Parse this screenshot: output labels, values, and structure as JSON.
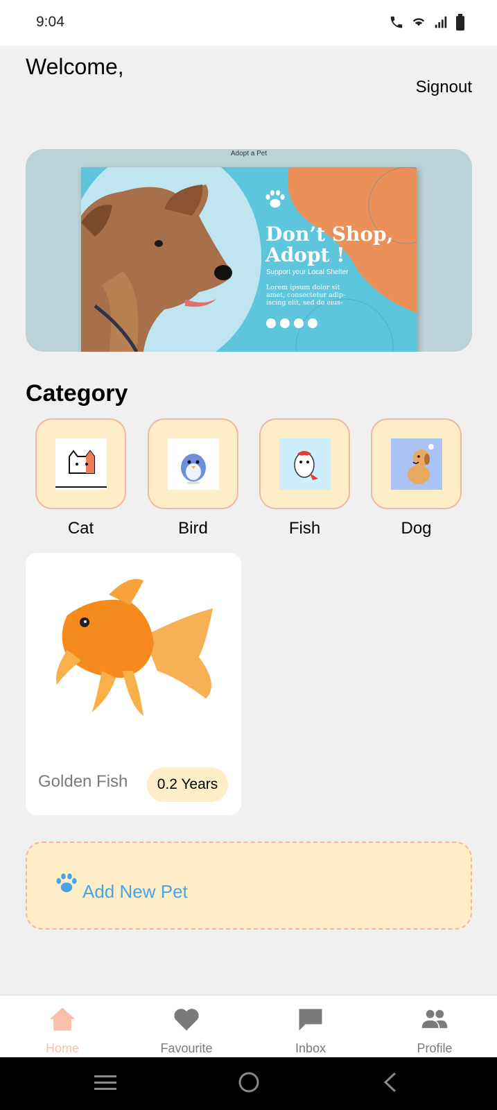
{
  "status_bar": {
    "time": "9:04"
  },
  "header": {
    "welcome": "Welcome,",
    "signout": "Signout"
  },
  "banner": {
    "caption": "Adopt a Pet",
    "headline_line1": "Don’t Shop,",
    "headline_line2": "Adopt !",
    "subtitle": "Support your Local Shelter",
    "body_line1": "Lorem ipsum dolor sit",
    "body_line2": "amet, consectetur adip-",
    "body_line3": "iscing elit, sed do eius-"
  },
  "category": {
    "title": "Category",
    "items": [
      {
        "label": "Cat",
        "icon": "cat-icon"
      },
      {
        "label": "Bird",
        "icon": "bird-icon"
      },
      {
        "label": "Fish",
        "icon": "fish-icon"
      },
      {
        "label": "Dog",
        "icon": "dog-icon"
      }
    ]
  },
  "pets": [
    {
      "name": "Golden Fish",
      "age": "0.2 Years"
    }
  ],
  "add_pet": {
    "label": "Add New Pet",
    "icon": "paw-icon"
  },
  "bottom_nav": {
    "items": [
      {
        "label": "Home",
        "icon": "home-icon",
        "active": true
      },
      {
        "label": "Favourite",
        "icon": "heart-icon",
        "active": false
      },
      {
        "label": "Inbox",
        "icon": "chat-icon",
        "active": false
      },
      {
        "label": "Profile",
        "icon": "people-icon",
        "active": false
      }
    ]
  },
  "colors": {
    "background": "#f0f0f1",
    "tile_fill": "#fdeec8",
    "tile_border": "#f3b8a4",
    "accent_blue": "#4ba3e6",
    "active_nav": "#f8c0ab",
    "inactive_nav": "#7a7a7a"
  }
}
